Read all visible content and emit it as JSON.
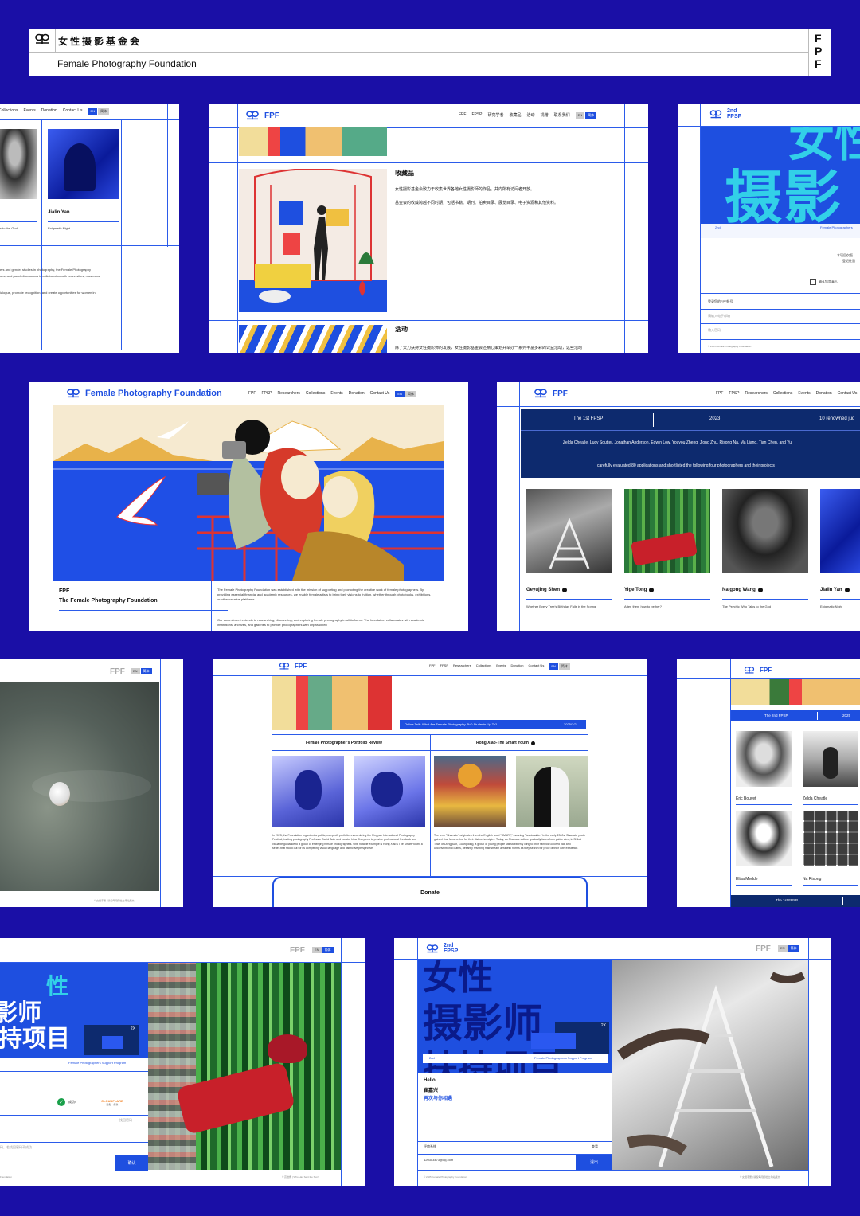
{
  "header": {
    "title_cn": "女性摄影基金会",
    "title_en": "Female Photography Foundation",
    "side_letters": [
      "F",
      "P",
      "F"
    ]
  },
  "colors": {
    "background": "#1a0fa6",
    "accent": "#1e4fe0",
    "line": "#2b5bea"
  },
  "common": {
    "fpf": "FPF",
    "lang_en": "EN",
    "lang_cn": "简体",
    "second": "2nd",
    "fpsp": "FPSP"
  },
  "nav_en": [
    "FPF",
    "FPSP",
    "Researchers",
    "Collections",
    "Events",
    "Donation",
    "Contact Us"
  ],
  "nav_cn": [
    "FPF",
    "FPSP",
    "研究学者",
    "收藏品",
    "活动",
    "捐赠",
    "联系我们"
  ],
  "card1": {
    "nav": [
      "Collections",
      "Events",
      "Donation",
      "Contact Us"
    ],
    "name1": "Jialin Yan",
    "caption1": "s to the God",
    "caption2": "Enigmatic Night",
    "body1": "ers and gender studies in photography, the Female Photography",
    "body2": "ops, and panel discussions in collaboration with universities, museums,",
    "body3": "ialogue, promote recognition, and create opportunities for women in"
  },
  "card2": {
    "section1": "收藏品",
    "text1": "女性摄影基金会致力于收集世界各地女性摄影师的作品，并向所有访问者开放。",
    "text2": "基金会的收藏跨越不同时期，包括书籍、期刊、拍卖目录、展览目录、电子资源和其他资料。",
    "section2": "活动",
    "text3": "除了大力扶持女性摄影师的发展，女性摄影基金会还精心策划并举办一系列丰富多彩的公益活动，这些活动"
  },
  "card3": {
    "hero": "女性",
    "hero2": "摄影",
    "tag_left": "2nd",
    "tag_right": "Female Photographers",
    "label1": "本项目仅面",
    "label2": "登记性别",
    "checkbox": "确认您是真人",
    "field1": "登录您的FPF帐号",
    "field2": "请输入电子邮箱",
    "field3": "输入密码",
    "footer": "© 2025 Female Photography Foundation"
  },
  "card4": {
    "logo": "Female Photography Foundation",
    "label1": "FPF",
    "label2": "The Female Photography Foundation",
    "para1": "The Female Photography Foundation was established with the mission of supporting and promoting the creative work of female photographers. By providing essential financial and academic resources, we enable female artists to bring their visions to fruition, whether through photobooks, exhibitions, or other creative platforms.",
    "para2": "Our commitment extends to researching, discovering, and exploring female photography in all its forms. The foundation collaborates with academic institutions, archives, and galleries to provide photographers with unparalleled"
  },
  "card5": {
    "row1": [
      "The 1st FPSP",
      "2023",
      "10 renowned jud"
    ],
    "row2": "Zelda Cheatle, Lucy Soutter, Jonathan Anderson, Edwin Low, Youyou Zheng, Jiong Zhu, Risong Na, Ma Liang, Tian Chen, and Yu",
    "row3": "carefully evaluated 80 applications and shortlisted the following four photographers and their projects",
    "names": [
      "Geyujing Shen",
      "Yige Tong",
      "Naigong Wang",
      "Jialin Yan"
    ],
    "captions": [
      "Whether Every Tree's Birthday Falls in the Spring",
      "After, then, how to be her?",
      "The Psychic Who Talks to the God",
      "Enigmatic Night"
    ]
  },
  "card6": {
    "footer": "© 女摄手册 | 版权每阅阁社立场站展文"
  },
  "card7": {
    "event": "Online Talk: What Are Female Photography PhD Students Up To?",
    "date": "2025/2/21",
    "col1": "Female Photographer's Portfolio Review",
    "col2": "Rong Xiao-The Smart Youth",
    "text1": "In 2023, the Foundation organized a public, non-profit portfolio review during the Pingyao International Photography Festival, inviting photography Professor David Bate and curator Irina Chmyreva to provide professional feedback and valuable guidance to a group of emerging female photographers. One notable example is Rong Xiao's The Smart Youth, a series that stood out for its compelling visual language and distinctive perspective.",
    "text2": "The term \"Shamate\" originates from the English word \"SMART,\" meaning \"fashionable.\" In the early 2000s, Shamate youth gained viral fame online for their distinctive styles. Today, as Shamate culture gradually fades from public view, in Shibai Town of Dongguan, Guangdong, a group of young people still stubbornly cling to their rainbow-colored hair and unconventional outfits, defiantly resisting mainstream aesthetic norms as they search for proof of their own existence.",
    "donate": "Donate"
  },
  "card8": {
    "row1": [
      "The 2nd FPSP",
      "2025"
    ],
    "names": [
      "Eric Bouvet",
      "Zelda Cheatle",
      "Elisa Medde",
      "Na Risong"
    ],
    "bottom": "The 1st FPSP"
  },
  "card9": {
    "hero1": "性",
    "hero2": "影师",
    "hero3": "持项目",
    "badge": "2X",
    "tag": "Female Photographers Support Program",
    "captcha": "成功!",
    "cloud": "CLOUDFLARE",
    "cloud_sub": "隐私 · 条款",
    "field1": "找回密码",
    "field2": "码，若找回密码不成功",
    "btn": "确认",
    "footer_l": "Foundation",
    "footer_r": "© 高地角 | Who Has Sent the Sun?"
  },
  "card10": {
    "hero1": "女性",
    "hero2": "摄影师",
    "hero3": "扶持项目",
    "badge": "2X",
    "tag_l": "2nd",
    "tag_r": "Female Photographers Support Program",
    "hello": "Hello",
    "name": "崔嘉兴",
    "welcome": "再次与你相遇",
    "link1": "评审系统",
    "link2": "查看",
    "email": "120353473@qq.com",
    "logout": "退出",
    "footer_l": "© 2025 Female Photography Foundation",
    "footer_r": "© 女摄手册 | 版权每阅阁社立场站展文"
  }
}
